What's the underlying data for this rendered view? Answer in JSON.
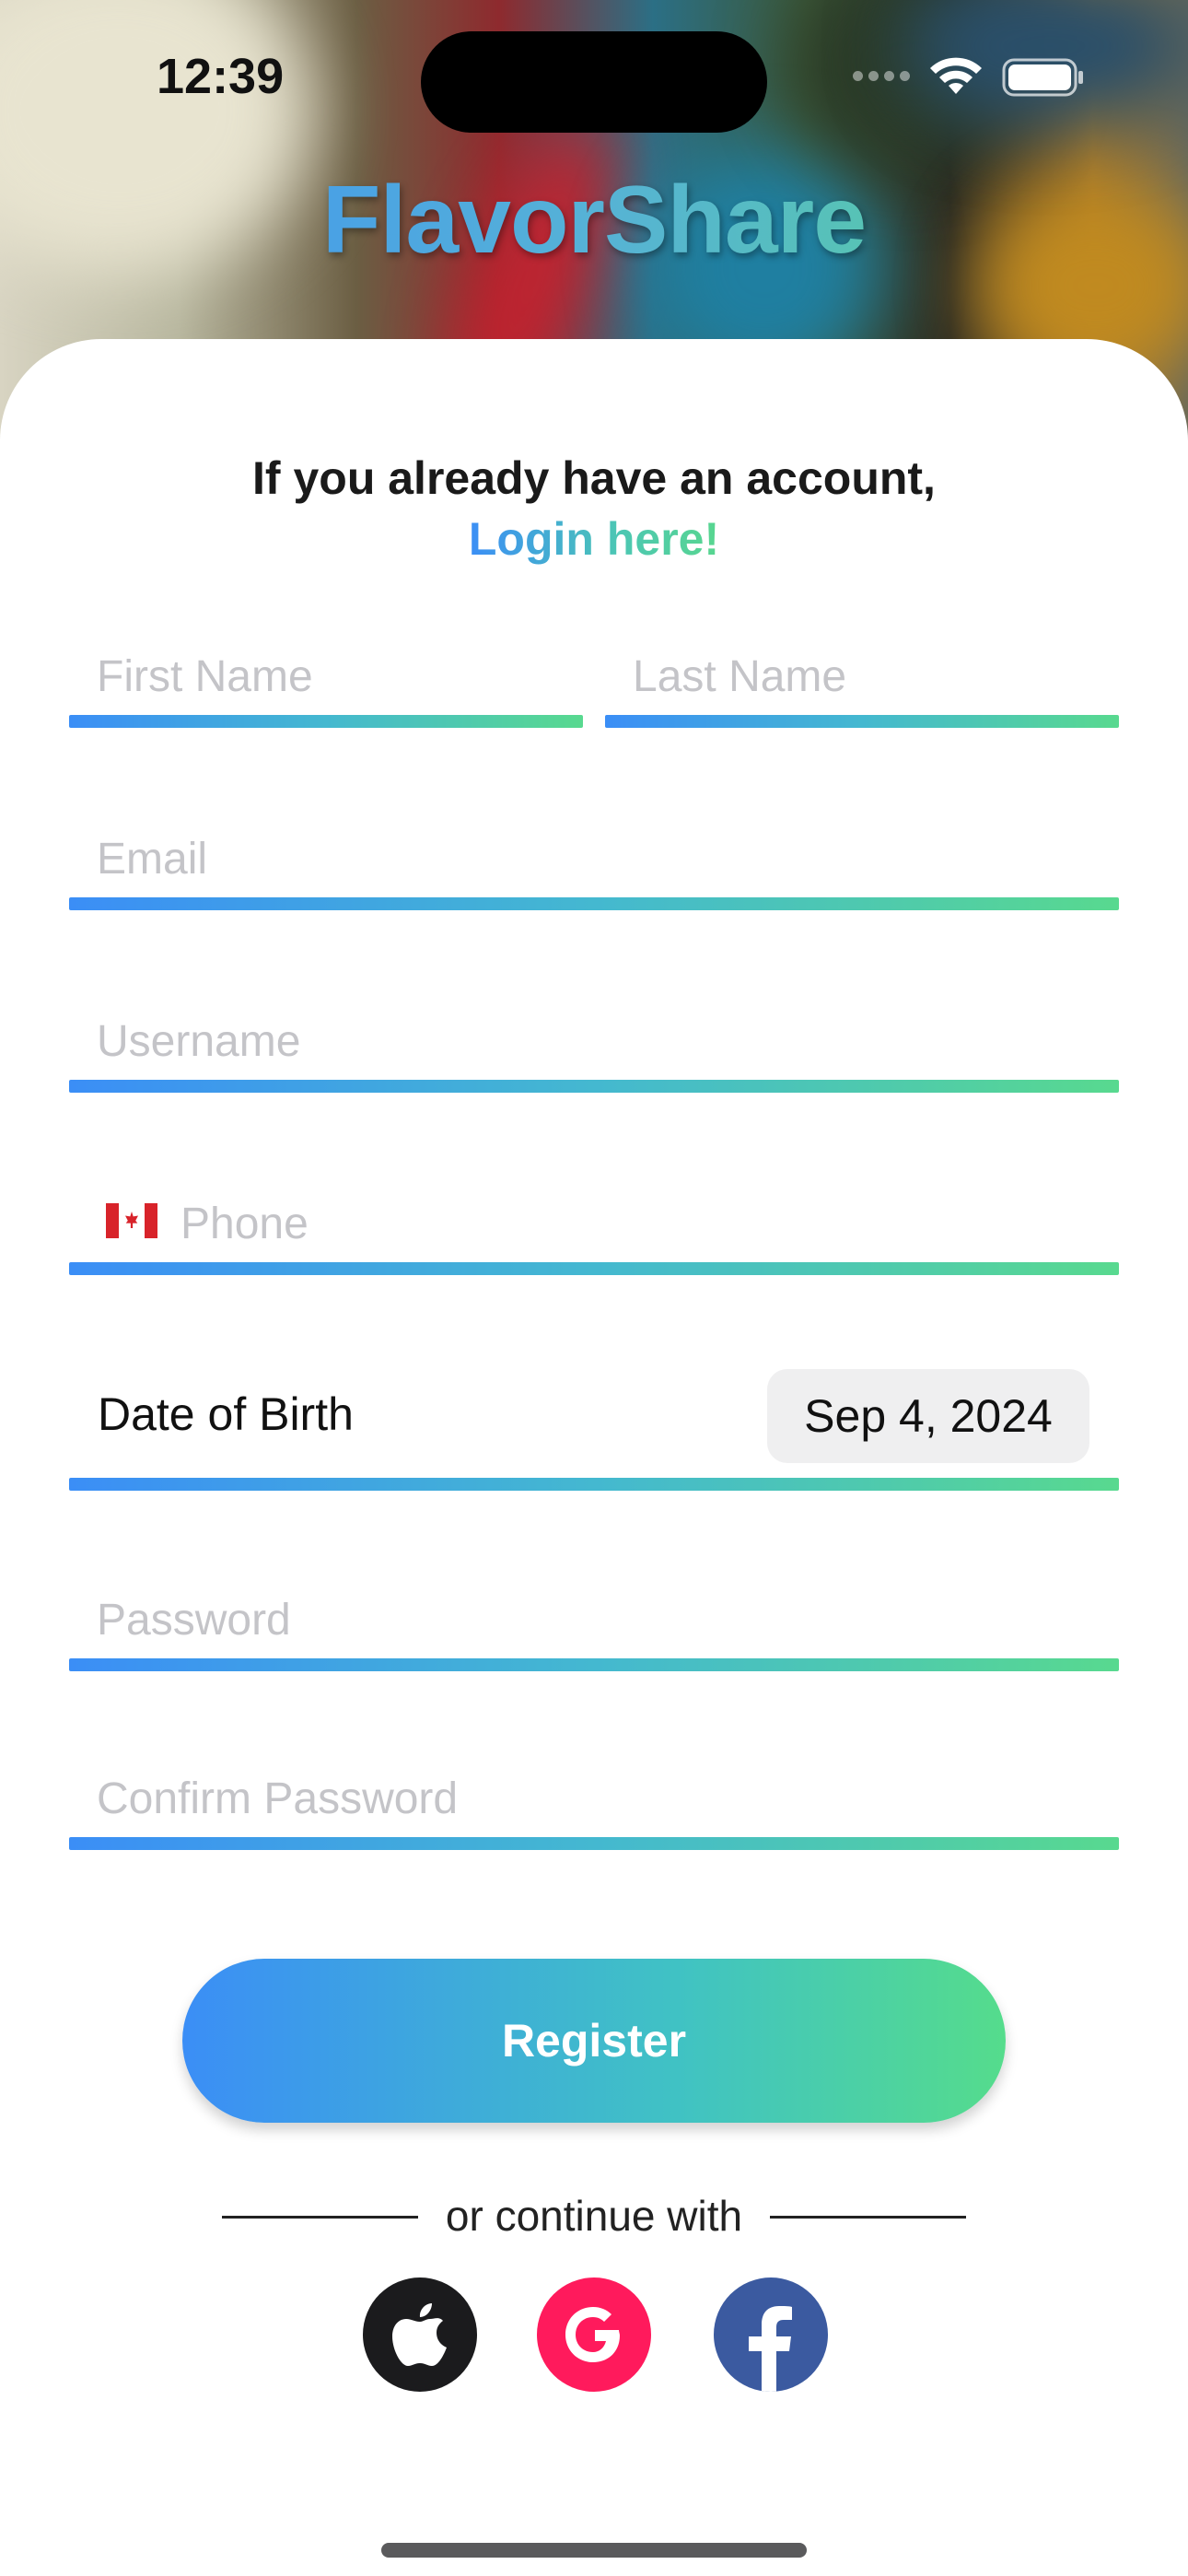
{
  "status_bar": {
    "time": "12:39"
  },
  "app": {
    "brand": "FlavorShare"
  },
  "intro": {
    "text": "If you already have an account,",
    "login_link": "Login here!"
  },
  "form": {
    "first_name_placeholder": "First Name",
    "last_name_placeholder": "Last Name",
    "email_placeholder": "Email",
    "username_placeholder": "Username",
    "phone_placeholder": "Phone",
    "phone_country_flag": "canada-flag",
    "dob_label": "Date of Birth",
    "dob_value": "Sep 4, 2024",
    "password_placeholder": "Password",
    "confirm_password_placeholder": "Confirm Password"
  },
  "actions": {
    "register_label": "Register",
    "divider_text": "or continue with"
  },
  "social": {
    "apple_icon": "apple-icon",
    "google_icon": "google-icon",
    "facebook_icon": "facebook-icon"
  },
  "colors": {
    "gradient_start": "#3b8ef6",
    "gradient_end": "#58d98f",
    "google": "#ff1a5c",
    "facebook": "#3b5aa0",
    "apple": "#1b1b1d"
  }
}
